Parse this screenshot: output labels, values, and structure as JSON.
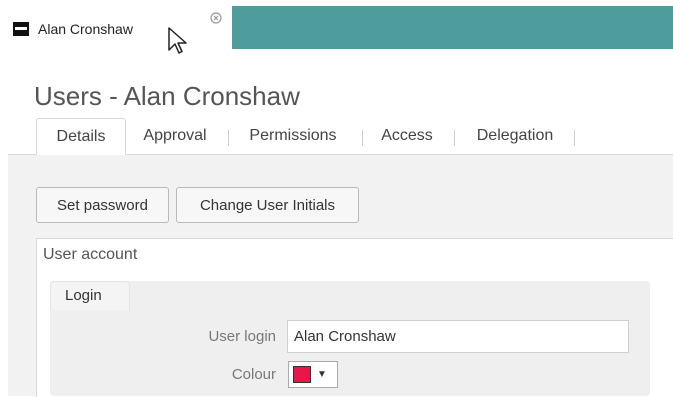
{
  "window_tab": {
    "title": "Alan Cronshaw"
  },
  "page": {
    "title": "Users - Alan Cronshaw"
  },
  "tabs": [
    {
      "label": "Details",
      "active": true
    },
    {
      "label": "Approval",
      "active": false
    },
    {
      "label": "Permissions",
      "active": false
    },
    {
      "label": "Access",
      "active": false
    },
    {
      "label": "Delegation",
      "active": false
    }
  ],
  "actions": {
    "set_password": "Set password",
    "change_initials": "Change User Initials"
  },
  "user_account": {
    "legend": "User account",
    "login": {
      "tab_label": "Login",
      "user_login_label": "User login",
      "user_login_value": "Alan Cronshaw",
      "colour_label": "Colour",
      "colour_value": "#e8174a"
    }
  },
  "colors": {
    "accent_bar": "#4e9c9b"
  }
}
